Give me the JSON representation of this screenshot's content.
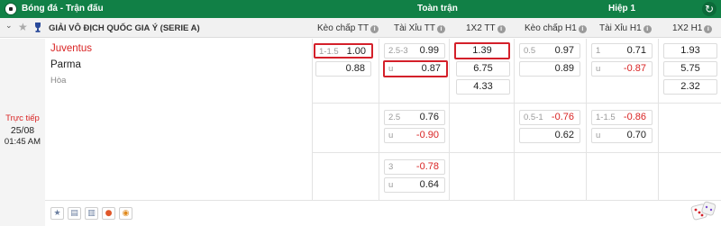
{
  "topbar": {
    "breadcrumb": "Bóng đá - Trận đấu",
    "full_time": "Toàn trận",
    "half_time": "Hiệp 1",
    "refresh_icon": "refresh-icon"
  },
  "league": {
    "name": "GIẢI VÔ ĐỊCH QUỐC GIA Ý (SERIE A)",
    "headers": [
      "Kèo chấp TT",
      "Tài Xỉu TT",
      "1X2 TT",
      "Kèo chấp H1",
      "Tài Xỉu H1",
      "1X2 H1"
    ]
  },
  "match": {
    "home": "Juventus",
    "away": "Parma",
    "draw": "Hòa",
    "status": "Trực tiếp",
    "date": "25/08",
    "time": "01:45 AM"
  },
  "odds": {
    "row1": {
      "hcp_tt": [
        {
          "label": "1-1.5",
          "value": "1.00"
        },
        {
          "label": "",
          "value": "0.88"
        }
      ],
      "ou_tt": [
        {
          "label": "2.5-3",
          "value": "0.99"
        },
        {
          "label": "u",
          "value": "0.87"
        }
      ],
      "x12_tt": [
        "1.39",
        "6.75",
        "4.33"
      ],
      "hcp_h1": [
        {
          "label": "0.5",
          "value": "0.97"
        },
        {
          "label": "",
          "value": "0.89"
        }
      ],
      "ou_h1": [
        {
          "label": "1",
          "value": "0.71"
        },
        {
          "label": "u",
          "value": "-0.87"
        }
      ],
      "x12_h1": [
        "1.93",
        "5.75",
        "2.32"
      ]
    },
    "row2": {
      "ou_tt": [
        {
          "label": "2.5",
          "value": "0.76"
        },
        {
          "label": "u",
          "value": "-0.90"
        }
      ],
      "hcp_h1": [
        {
          "label": "0.5-1",
          "value": "-0.76"
        },
        {
          "label": "",
          "value": "0.62"
        }
      ],
      "ou_h1": [
        {
          "label": "1-1.5",
          "value": "-0.86"
        },
        {
          "label": "u",
          "value": "0.70"
        }
      ]
    },
    "row3": {
      "ou_tt": [
        {
          "label": "3",
          "value": "-0.78"
        },
        {
          "label": "u",
          "value": "0.64"
        }
      ]
    }
  },
  "colors": {
    "brand_green": "#118046",
    "negative_red": "#d92323",
    "highlight_border": "#d4202a"
  }
}
